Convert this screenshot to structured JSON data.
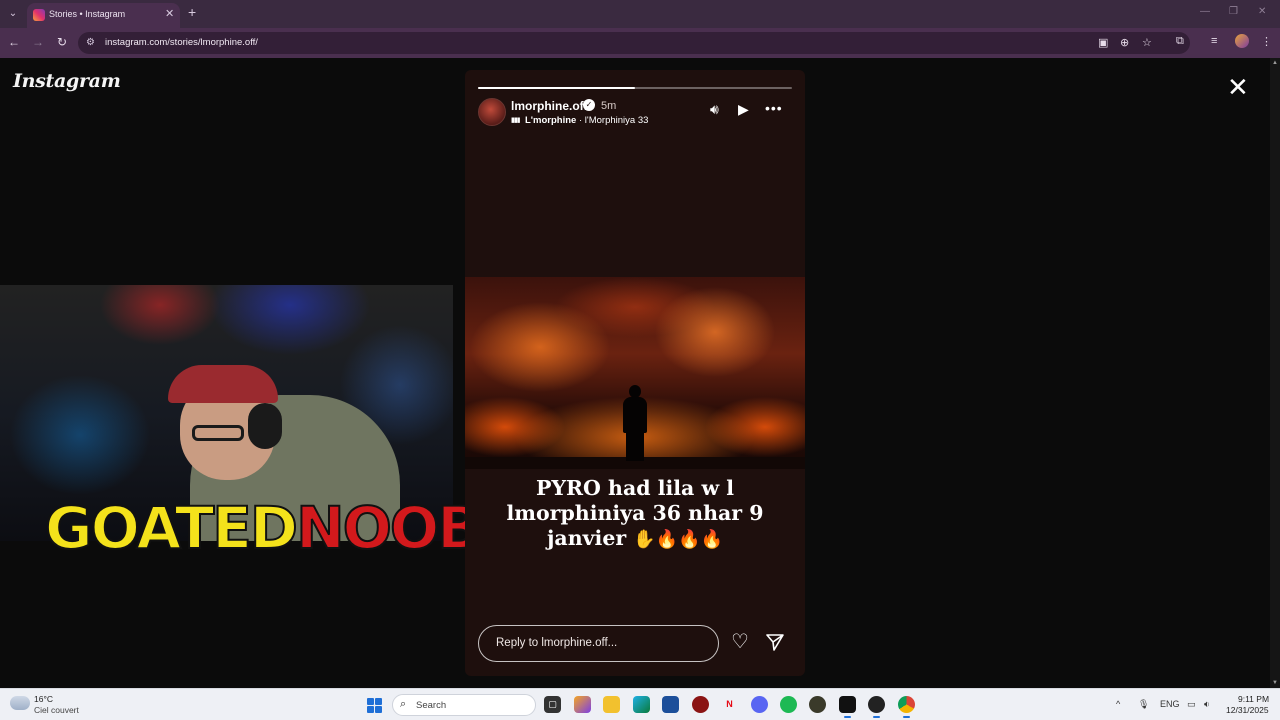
{
  "browser": {
    "tab_title": "Stories • Instagram",
    "tab_close": "✕",
    "tab_menu": "⌄",
    "new_tab": "+",
    "url": "instagram.com/stories/lmorphine.off/",
    "window_controls": {
      "minimize": "—",
      "restore": "❐",
      "close": "✕"
    }
  },
  "page": {
    "logo": "Instagram",
    "close_viewer": "✕"
  },
  "webcam": {
    "name_part1": "GOATED",
    "name_part2": "NOOBIE"
  },
  "story": {
    "progress": 0.5,
    "username": "lmorphine.off",
    "verified": "✓",
    "time": "5m",
    "music_artist": "L'morphine",
    "music_separator": " · ",
    "music_track": "l'Morphiniya 33",
    "caption_line1": "PYRO had lila w l",
    "caption_line2": "lmorphiniya 36 nhar 9",
    "caption_line3": "janvier",
    "caption_emojis": "✋🔥🔥🔥",
    "reply_placeholder": "Reply to lmorphine.off...",
    "icons": [
      "speaker-icon",
      "play-icon",
      "more-icon",
      "heart-icon",
      "send-icon"
    ],
    "accent_colors": {
      "background": "#1e0f0d",
      "fire": "#ff8a1f"
    }
  },
  "taskbar": {
    "weather_temp": "16°C",
    "weather_desc": "Ciel couvert",
    "search_label": "Search",
    "language": "ENG",
    "clock_time": "9:11 PM",
    "clock_date": "12/31/2025"
  }
}
